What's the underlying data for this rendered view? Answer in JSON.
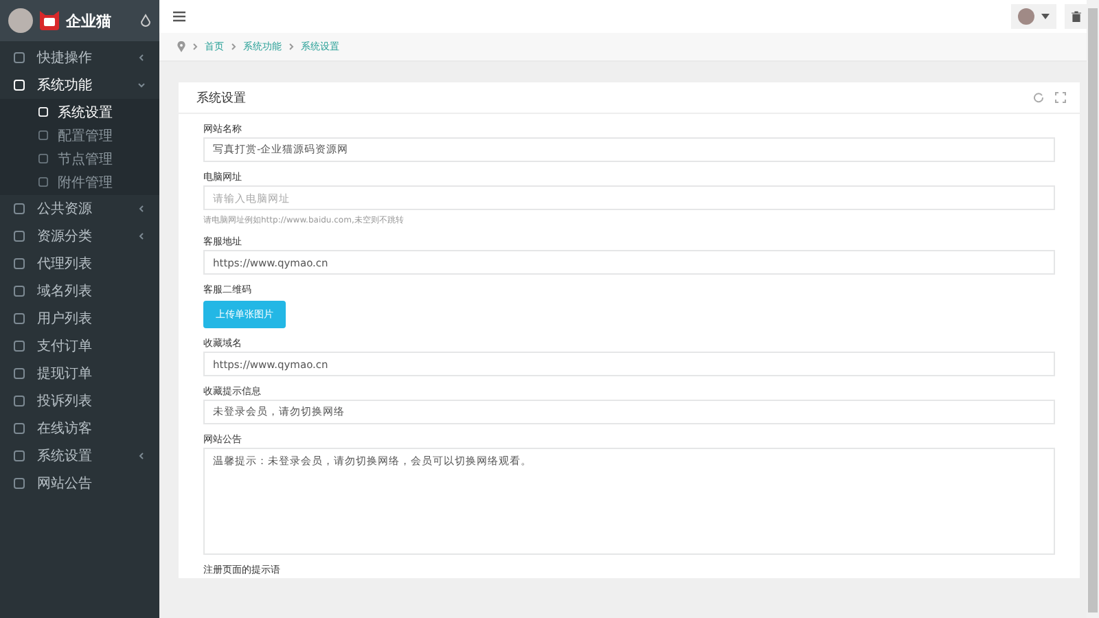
{
  "logo": {
    "text": "企业猫"
  },
  "sidebar": {
    "items": [
      {
        "label": "快捷操作",
        "has_children": true,
        "expanded": false,
        "selected": false
      },
      {
        "label": "系统功能",
        "has_children": true,
        "expanded": true,
        "selected": true,
        "children": [
          {
            "label": "系统设置",
            "selected": true
          },
          {
            "label": "配置管理",
            "selected": false
          },
          {
            "label": "节点管理",
            "selected": false
          },
          {
            "label": "附件管理",
            "selected": false
          }
        ]
      },
      {
        "label": "公共资源",
        "has_children": true,
        "expanded": false,
        "selected": false
      },
      {
        "label": "资源分类",
        "has_children": true,
        "expanded": false,
        "selected": false
      },
      {
        "label": "代理列表",
        "has_children": false,
        "selected": false
      },
      {
        "label": "域名列表",
        "has_children": false,
        "selected": false
      },
      {
        "label": "用户列表",
        "has_children": false,
        "selected": false
      },
      {
        "label": "支付订单",
        "has_children": false,
        "selected": false
      },
      {
        "label": "提现订单",
        "has_children": false,
        "selected": false
      },
      {
        "label": "投诉列表",
        "has_children": false,
        "selected": false
      },
      {
        "label": "在线访客",
        "has_children": false,
        "selected": false
      },
      {
        "label": "系统设置",
        "has_children": true,
        "expanded": false,
        "selected": false
      },
      {
        "label": "网站公告",
        "has_children": false,
        "selected": false
      }
    ]
  },
  "breadcrumb": [
    "首页",
    "系统功能",
    "系统设置"
  ],
  "card": {
    "title": "系统设置",
    "fields": [
      {
        "kind": "input",
        "label": "网站名称",
        "value": "写真打赏-企业猫源码资源网"
      },
      {
        "kind": "input",
        "label": "电脑网址",
        "placeholder": "请输入电脑网址",
        "help": "请电脑网址例如http://www.baidu.com,未空则不跳转"
      },
      {
        "kind": "input",
        "label": "客服地址",
        "value": "https://www.qymao.cn"
      },
      {
        "kind": "upload",
        "label": "客服二维码",
        "button": "上传单张图片"
      },
      {
        "kind": "input",
        "label": "收藏域名",
        "value": "https://www.qymao.cn"
      },
      {
        "kind": "input",
        "label": "收藏提示信息",
        "value": "未登录会员，请勿切换网络"
      },
      {
        "kind": "textarea",
        "label": "网站公告",
        "value": "温馨提示：未登录会员，请勿切换网络，会员可以切换网络观看。"
      },
      {
        "kind": "label",
        "label": "注册页面的提示语"
      }
    ]
  }
}
